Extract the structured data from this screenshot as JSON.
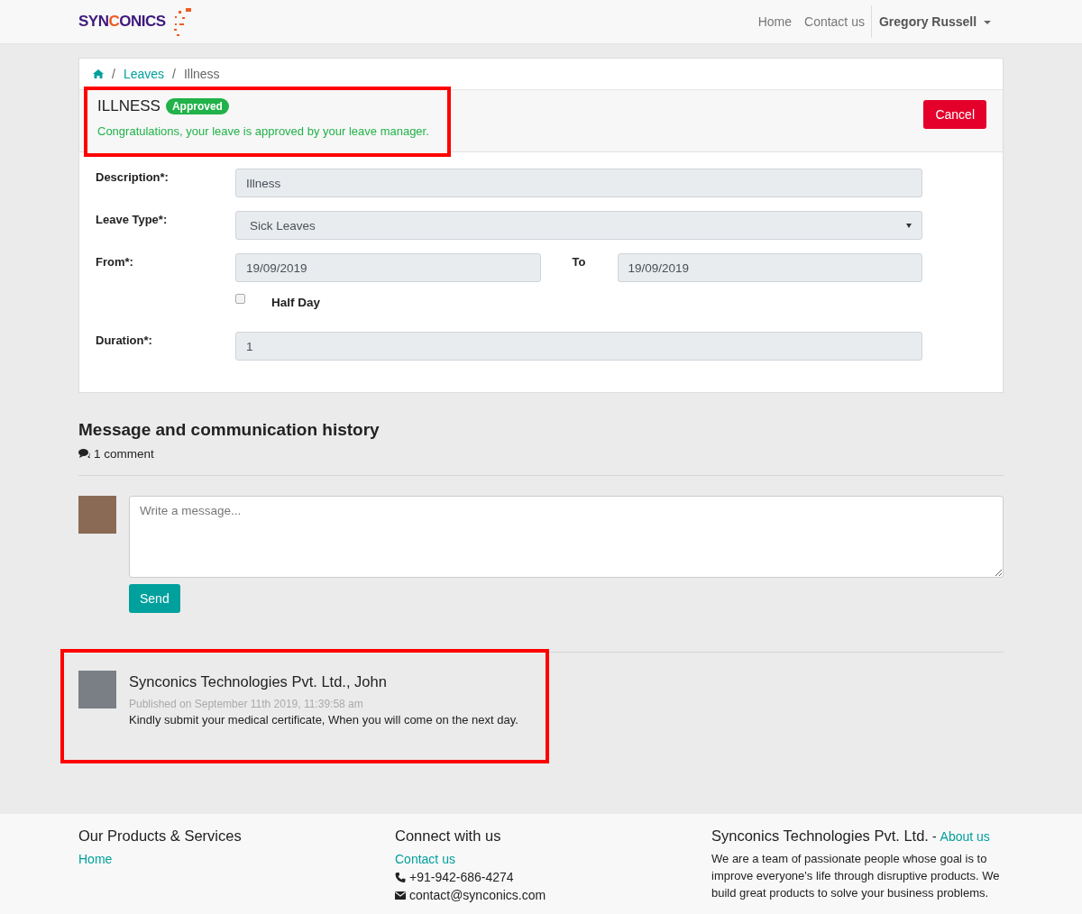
{
  "navbar": {
    "logo": "SYNCONICS",
    "links": [
      {
        "label": "Home"
      },
      {
        "label": "Contact us"
      }
    ],
    "user": "Gregory Russell"
  },
  "breadcrumb": [
    {
      "separator": "/",
      "label": "Leaves",
      "kind": "link"
    },
    {
      "separator": "/",
      "label": "Illness",
      "kind": "current"
    }
  ],
  "leave": {
    "title": "ILLNESS",
    "status": "Approved",
    "message": "Congratulations, your leave is approved by your leave manager.",
    "cancel_button": "Cancel",
    "fields": [
      {
        "kind": "text",
        "label": "Description*:",
        "value": "Illness"
      },
      {
        "kind": "select",
        "label": "Leave Type*:",
        "value": "Sick Leaves"
      },
      {
        "kind": "range",
        "label": "From*:",
        "value": "19/09/2019",
        "to_label": "To",
        "to_value": "19/09/2019"
      },
      {
        "kind": "checkbox",
        "label": "Half Day",
        "checked": false
      },
      {
        "kind": "text",
        "label": "Duration*:",
        "value": "1"
      }
    ]
  },
  "history": {
    "title": "Message and communication history",
    "comment_count": "1 comment",
    "placeholder": "Write a message...",
    "send_button": "Send",
    "comments": [
      {
        "author": "Synconics Technologies Pvt. Ltd., John",
        "date": "Published on September 11th 2019, 11:39:58 am",
        "body": "Kindly submit your medical certificate, When you will come on the next day."
      }
    ]
  },
  "footer": {
    "col1": {
      "title": "Our Products & Services",
      "links": [
        "Home"
      ]
    },
    "col2": {
      "title": "Connect with us",
      "link": "Contact us",
      "phone": "+91-942-686-4274",
      "email": "contact@synconics.com"
    },
    "col3": {
      "title": "Synconics Technologies Pvt. Ltd.",
      "separator": "-",
      "link": "About us",
      "text": "We are a team of passionate people whose goal is to improve everyone's life through disruptive products. We build great products to solve your business problems."
    }
  }
}
